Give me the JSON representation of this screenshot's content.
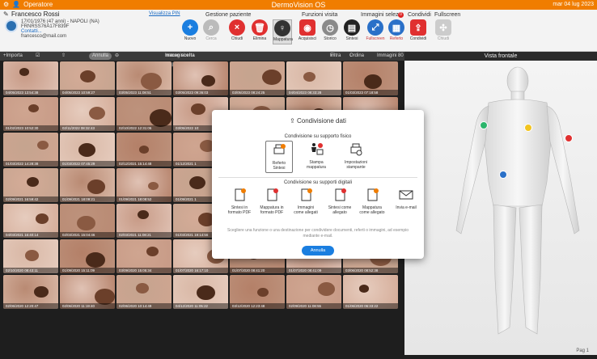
{
  "topbar": {
    "user": "Operatore",
    "title": "DermoVision OS",
    "datetime": "mar 04 lug 2023"
  },
  "patient": {
    "name": "Francesco Rossi",
    "line1": "17/01/1976 (47 anni) - NAPOLI (NA)",
    "line2": "FRNRSS76A17F839F",
    "line3": "Contatti...",
    "line4": "francesco@mail.com",
    "link": "Visualizza PIN"
  },
  "ribbon": {
    "group_patient": "Gestione paziente",
    "group_visit": "Funzioni visita",
    "group_images": "Immagini selez.",
    "group_share": "Condividi",
    "group_full": "Fullscreen",
    "images_badge": "0",
    "tools": [
      {
        "label": "Nuovo"
      },
      {
        "label": "Cerca"
      },
      {
        "label": "Chiudi"
      },
      {
        "label": "Elimina"
      },
      {
        "label": "Mappatura"
      },
      {
        "label": "Acquisisci"
      },
      {
        "label": "Storico"
      },
      {
        "label": "Sintesi"
      },
      {
        "label": "Fullscreen"
      },
      {
        "label": "Referto"
      },
      {
        "label": "Condividi"
      },
      {
        "label": "Chiudi"
      }
    ]
  },
  "toolbar2": {
    "import": "+Importa",
    "annulla": "Annulla",
    "center": "Immagini e mappe della",
    "center_bold": "macro scelta",
    "filtra": "Filtra",
    "ordina": "Ordina",
    "immagini": "Immagini 80",
    "more": "..."
  },
  "vista": {
    "title": "Vista frontale",
    "page": "Pag 1"
  },
  "grid": {
    "labels": [
      "04/05/2023 13:54:38",
      "04/05/2023 10:59:27",
      "03/05/2023 11:08:51",
      "03/05/2023 09:36:03",
      "03/05/2023 08:24:25",
      "04/04/2023 08:33:28",
      "01/03/2023 07:18:58",
      "01/02/2023 10:52:30",
      "02/11/2022 08:32:43",
      "02/10/2022 12:31:06",
      "03/05/2022 10:",
      "",
      "",
      "01/01/2022 10:38:45",
      "01/03/2022 14:28:38",
      "01/03/2022 07:45:29",
      "02/12/2021 15:14:48",
      "01/12/2021 1",
      "",
      "",
      "01/12/2021 18:14:55",
      "02/09/2021 16:59:42",
      "01/09/2021 18:09:21",
      "01/09/2021 18:08:52",
      "01/09/2021 1",
      "",
      "",
      "01/12/2021 11:55:15",
      "04/03/2021 16:40:14",
      "02/03/2021 15:04:46",
      "02/03/2021 11:08:21",
      "01/03/2021 19:14:56",
      "01/02/2021 18:07:09",
      "01/12/2020 03:39:49",
      "02/11/2020 18:01:26",
      "02/10/2020 08:43:11",
      "01/09/2020 15:11:09",
      "03/09/2020 15:05:34",
      "01/07/2020 16:17:10",
      "01/07/2020 08:41:20",
      "01/07/2020 08:41:09",
      "03/06/2020 08:52:38",
      "02/06/2020 12:20:47",
      "02/06/2020 11:19:40",
      "02/06/2020 10:14:49",
      "04/12/2020 11:05:22",
      "03/12/2020 12:23:48",
      "02/09/2020 11:08:55",
      "01/06/2020 06:33:22"
    ]
  },
  "modal": {
    "title": "Condivisione dati",
    "physical": "Condivisione su supporto fisico",
    "digital": "Condivisione su supporti digitali",
    "p_items": [
      "Referto\nSintesi",
      "Stampa\nmappatura",
      "Impostazioni\nstampante"
    ],
    "d_items": [
      "Sintesi in\nformato PDF",
      "Mappatura in\nformato PDF",
      "Immagini\ncome allegati",
      "Sintesi come\nallegato",
      "Mappatura\ncome allegato",
      "Invia e-mail"
    ],
    "note": "Scegliere una funzione o una destinazione per condividere documenti, referti o immagini, ad esempio mediante e-mail.",
    "cancel": "Annulla"
  }
}
